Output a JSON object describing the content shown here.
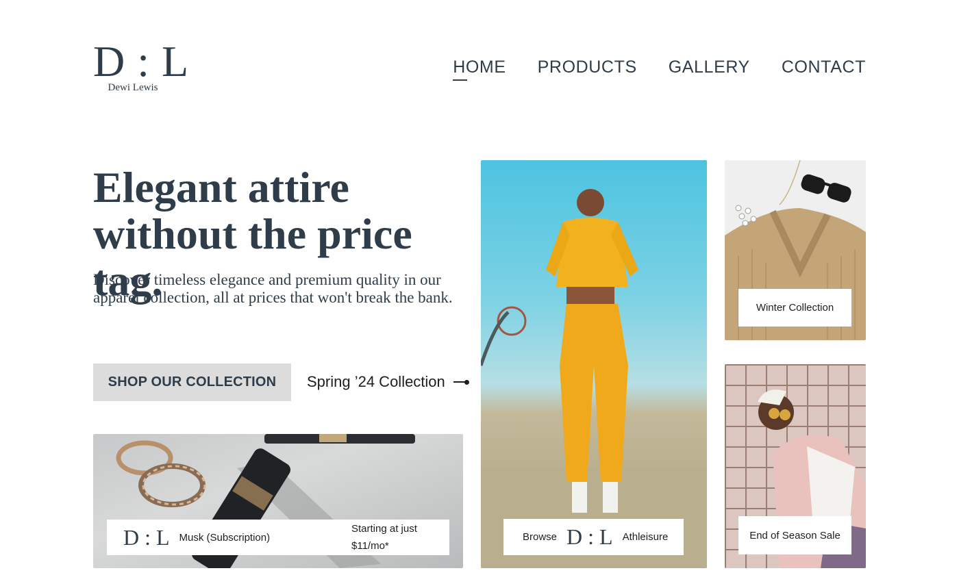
{
  "logo": {
    "mark": "D : L",
    "name": "Dewi Lewis"
  },
  "nav": {
    "items": [
      {
        "label": "HOME",
        "active": true
      },
      {
        "label": "PRODUCTS",
        "active": false
      },
      {
        "label": "GALLERY",
        "active": false
      },
      {
        "label": "CONTACT",
        "active": false
      }
    ]
  },
  "hero": {
    "title_line1": "Elegant attire",
    "title_line2": "without the price tag.",
    "description": "Discover timeless elegance and premium quality in our apparel collection, all at prices that won't break the bank.",
    "shop_button": "SHOP OUR COLLECTION",
    "spring_link": "Spring ’24 Collection"
  },
  "cards": {
    "musk": {
      "logo": "D : L",
      "name": "Musk (Subscription)",
      "price": "Starting at just $11/mo*"
    },
    "athleisure": {
      "prefix": "Browse",
      "logo": "D : L",
      "name": "Athleisure"
    },
    "winter": {
      "label": "Winter Collection"
    },
    "sale": {
      "label": "End of Season Sale"
    }
  },
  "colors": {
    "text": "#2f3c4a",
    "button_bg": "#dcdcdd",
    "outfit_yellow": "#f2b21f"
  }
}
